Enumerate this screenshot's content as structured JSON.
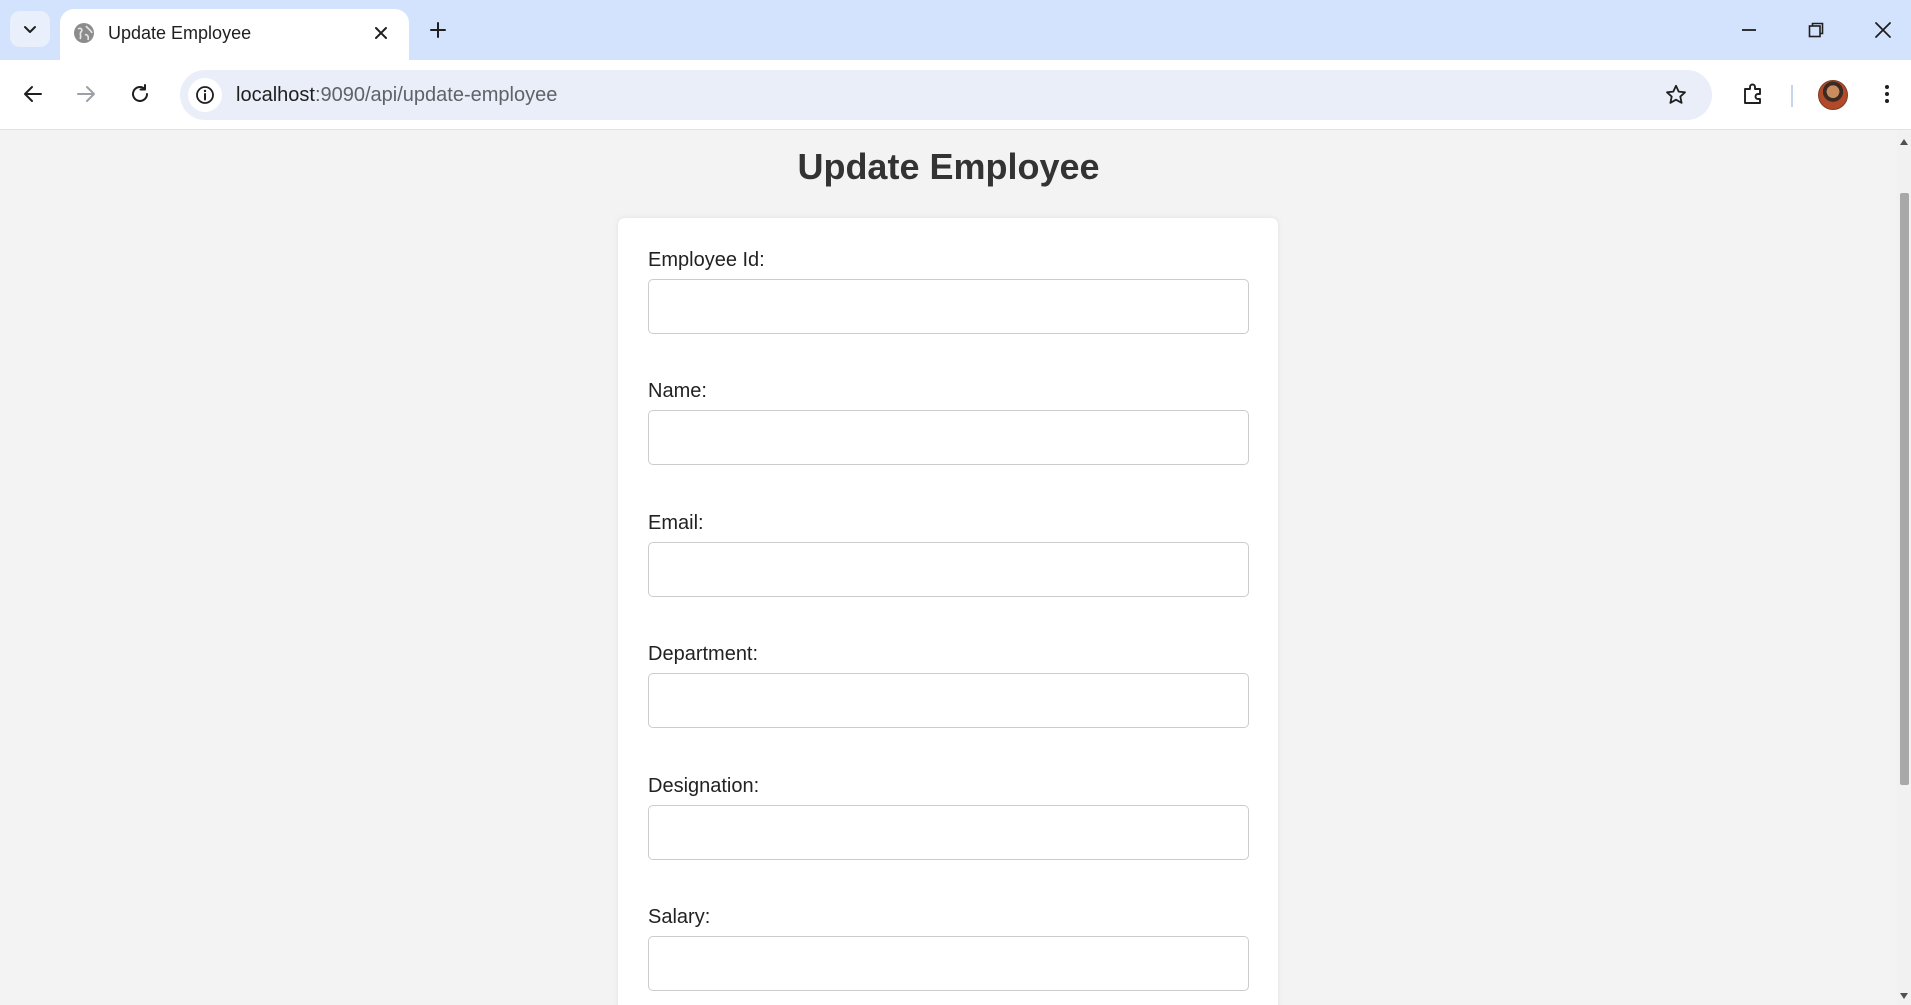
{
  "browser": {
    "tab_title": "Update Employee",
    "url_host": "localhost",
    "url_path": ":9090/api/update-employee"
  },
  "page": {
    "title": "Update Employee"
  },
  "form": {
    "fields": [
      {
        "label": "Employee Id:",
        "value": ""
      },
      {
        "label": "Name:",
        "value": ""
      },
      {
        "label": "Email:",
        "value": ""
      },
      {
        "label": "Department:",
        "value": ""
      },
      {
        "label": "Designation:",
        "value": ""
      },
      {
        "label": "Salary:",
        "value": ""
      }
    ]
  },
  "colors": {
    "tabstrip": "#d3e3fd",
    "page_background": "#f3f3f3",
    "card_background": "#ffffff",
    "title_text": "#333333"
  }
}
